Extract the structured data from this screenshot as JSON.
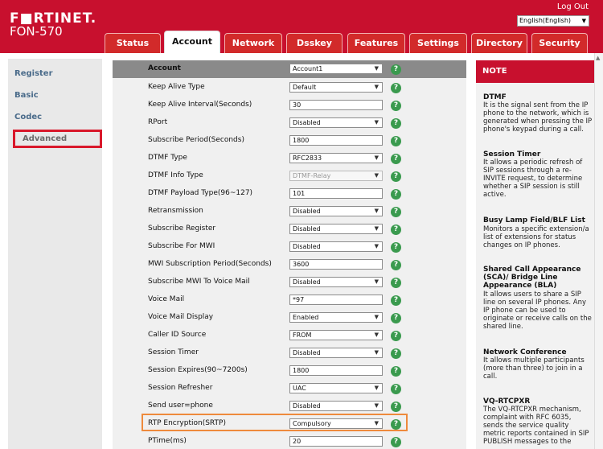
{
  "header": {
    "logo": "F■RTINET.",
    "model": "FON-570",
    "logout": "Log Out",
    "language": "English(English)"
  },
  "tabs": [
    {
      "label": "Status"
    },
    {
      "label": "Account"
    },
    {
      "label": "Network"
    },
    {
      "label": "Dsskey"
    },
    {
      "label": "Features"
    },
    {
      "label": "Settings"
    },
    {
      "label": "Directory"
    },
    {
      "label": "Security"
    }
  ],
  "sidebar": {
    "items": [
      {
        "label": "Register"
      },
      {
        "label": "Basic"
      },
      {
        "label": "Codec"
      },
      {
        "label": "Advanced"
      }
    ]
  },
  "form": {
    "header_label": "Account",
    "header_value": "Account1",
    "rows": [
      {
        "label": "Keep Alive Type",
        "value": "Default"
      },
      {
        "label": "Keep Alive Interval(Seconds)",
        "value": "30"
      },
      {
        "label": "RPort",
        "value": "Disabled"
      },
      {
        "label": "Subscribe Period(Seconds)",
        "value": "1800"
      },
      {
        "label": "DTMF Type",
        "value": "RFC2833"
      },
      {
        "label": "DTMF Info Type",
        "value": "DTMF-Relay"
      },
      {
        "label": "DTMF Payload Type(96~127)",
        "value": "101"
      },
      {
        "label": "Retransmission",
        "value": "Disabled"
      },
      {
        "label": "Subscribe Register",
        "value": "Disabled"
      },
      {
        "label": "Subscribe For MWI",
        "value": "Disabled"
      },
      {
        "label": "MWI Subscription Period(Seconds)",
        "value": "3600"
      },
      {
        "label": "Subscribe MWI To Voice Mail",
        "value": "Disabled"
      },
      {
        "label": "Voice Mail",
        "value": "*97"
      },
      {
        "label": "Voice Mail Display",
        "value": "Enabled"
      },
      {
        "label": "Caller ID Source",
        "value": "FROM"
      },
      {
        "label": "Session Timer",
        "value": "Disabled"
      },
      {
        "label": "Session Expires(90~7200s)",
        "value": "1800"
      },
      {
        "label": "Session Refresher",
        "value": "UAC"
      },
      {
        "label": "Send user=phone",
        "value": "Disabled"
      },
      {
        "label": "RTP Encryption(SRTP)",
        "value": "Compulsory"
      },
      {
        "label": "PTime(ms)",
        "value": "20"
      }
    ]
  },
  "note": {
    "heading": "NOTE",
    "sections": [
      {
        "title": "DTMF",
        "text": "It is the signal sent from the IP phone to the network, which is generated when pressing the IP phone's keypad during a call."
      },
      {
        "title": "Session Timer",
        "text": "It allows a periodic refresh of SIP sessions through a re-INVITE request, to determine whether a SIP session is still active."
      },
      {
        "title": "Busy Lamp Field/BLF List",
        "text": "Monitors a specific extension/a list of extensions for status changes on IP phones."
      },
      {
        "title": "Shared Call Appearance (SCA)/ Bridge Line Appearance (BLA)",
        "text": "It allows users to share a SIP line on several IP phones. Any IP phone can be used to originate or receive calls on the shared line."
      },
      {
        "title": "Network Conference",
        "text": "It allows multiple participants (more than three) to join in a call."
      },
      {
        "title": "VQ-RTCPXR",
        "text": "The VQ-RTCPXR mechanism, complaint with RFC 6035, sends the service quality metric reports contained in SIP PUBLISH messages to the"
      }
    ]
  }
}
